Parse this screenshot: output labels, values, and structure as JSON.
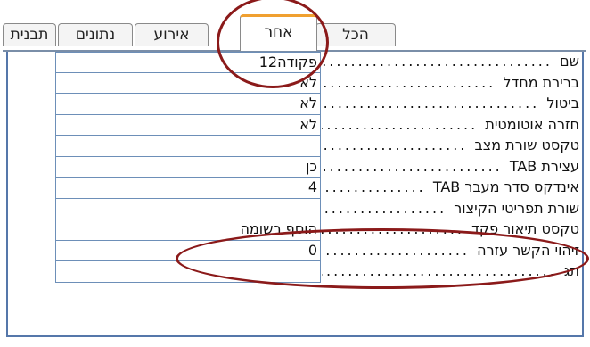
{
  "tabs": [
    {
      "label": "תבנית"
    },
    {
      "label": "נתונים"
    },
    {
      "label": "אירוע"
    },
    {
      "label": "אחר"
    },
    {
      "label": "הכל"
    }
  ],
  "active_tab": "אחר",
  "rows": [
    {
      "label": "שם",
      "value": "פקודה12"
    },
    {
      "label": "ברירת מחדל",
      "value": "לא"
    },
    {
      "label": "ביטול",
      "value": "לא"
    },
    {
      "label": "חזרה אוטומטית",
      "value": "לא"
    },
    {
      "label": "טקסט שורת מצב",
      "value": ""
    },
    {
      "label": "עצירת TAB",
      "value": "כן"
    },
    {
      "label": "אינדקס סדר מעבר TAB",
      "value": "4"
    },
    {
      "label": "שורת תפריטי הקיצור",
      "value": ""
    },
    {
      "label": "טקסט תיאור פקד",
      "value": "הוסף רשומה"
    },
    {
      "label": "זיהוי הקשר עזרה",
      "value": "0"
    },
    {
      "label": "תג",
      "value": ""
    }
  ],
  "colors": {
    "annotation": "#8b1a1a",
    "active_tab_accent": "#f0a030",
    "grid_border": "#6d8fb8"
  }
}
